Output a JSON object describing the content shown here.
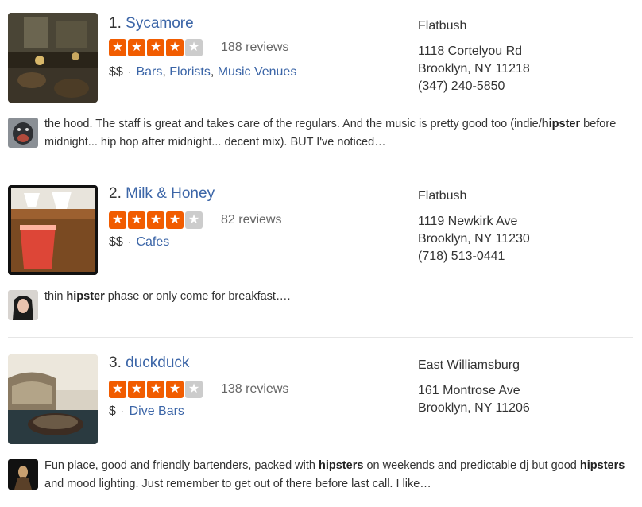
{
  "results": [
    {
      "rank": "1.",
      "name": "Sycamore",
      "review_count": "188 reviews",
      "price": "$$",
      "categories": [
        "Bars",
        "Florists",
        "Music Venues"
      ],
      "neighborhood": "Flatbush",
      "address_line1": "1118 Cortelyou Rd",
      "address_line2": "Brooklyn, NY 11218",
      "phone": "(347) 240-5850",
      "rating_stars": 4,
      "photo_icon": "bar-photo",
      "avatar_icon": "user-avatar-gorilla",
      "snippet": [
        "the hood.  The staff is great and takes care of the regulars.  And the music is pretty good too (indie/",
        "hipster",
        " before midnight... hip hop after midnight... decent mix).    BUT I've noticed…"
      ]
    },
    {
      "rank": "2.",
      "name": "Milk & Honey",
      "review_count": "82 reviews",
      "price": "$$",
      "categories": [
        "Cafes"
      ],
      "neighborhood": "Flatbush",
      "address_line1": "1119 Newkirk Ave",
      "address_line2": "Brooklyn, NY 11230",
      "phone": "(718) 513-0441",
      "rating_stars": 4,
      "photo_icon": "cafe-drink-photo",
      "avatar_icon": "user-avatar-woman",
      "snippet": [
        "thin ",
        "hipster",
        " phase or only come for breakfast…."
      ]
    },
    {
      "rank": "3.",
      "name": "duckduck",
      "review_count": "138 reviews",
      "price": "$",
      "categories": [
        "Dive Bars"
      ],
      "neighborhood": "East Williamsburg",
      "address_line1": "161 Montrose Ave",
      "address_line2": "Brooklyn, NY 11206",
      "phone": "",
      "rating_stars": 4,
      "photo_icon": "dive-bar-photo",
      "avatar_icon": "user-avatar-dark",
      "snippet": [
        "Fun place, good and friendly bartenders, packed with  ",
        "hipsters",
        " on weekends and predictable dj but good ",
        "hipsters",
        " and mood lighting. Just remember to get out of there before last call.  I like…"
      ]
    }
  ],
  "colors": {
    "link": "#3b65a7",
    "star_on": "#f15c00",
    "star_off": "#cccccc"
  }
}
